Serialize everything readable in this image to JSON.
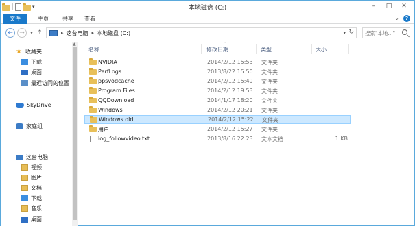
{
  "window": {
    "title": "本地磁盘 (C:)",
    "controls": {
      "minimize": "–",
      "maximize": "□",
      "close": "✕"
    }
  },
  "ribbon": {
    "file": "文件",
    "home": "主页",
    "share": "共享",
    "view": "查看",
    "help": "?"
  },
  "address": {
    "segments": [
      "这台电脑",
      "本地磁盘 (C:)"
    ]
  },
  "search": {
    "placeholder": "搜索\"本地...\""
  },
  "nav": {
    "favorites": "收藏夹",
    "fav_items": [
      "下载",
      "桌面",
      "最近访问的位置"
    ],
    "skydrive": "SkyDrive",
    "homegroup": "家庭组",
    "thispc": "这台电脑",
    "pc_items": [
      "视频",
      "图片",
      "文档",
      "下载",
      "音乐",
      "桌面"
    ]
  },
  "columns": {
    "name": "名称",
    "date": "修改日期",
    "type": "类型",
    "size": "大小"
  },
  "files": [
    {
      "name": "NVIDIA",
      "date": "2014/2/12 15:53",
      "type": "文件夹",
      "size": "",
      "kind": "folder"
    },
    {
      "name": "PerfLogs",
      "date": "2013/8/22 15:50",
      "type": "文件夹",
      "size": "",
      "kind": "folder"
    },
    {
      "name": "ppsvodcache",
      "date": "2014/2/12 15:49",
      "type": "文件夹",
      "size": "",
      "kind": "folder"
    },
    {
      "name": "Program Files",
      "date": "2014/2/12 19:53",
      "type": "文件夹",
      "size": "",
      "kind": "folder"
    },
    {
      "name": "QQDownload",
      "date": "2014/1/17 18:20",
      "type": "文件夹",
      "size": "",
      "kind": "folder"
    },
    {
      "name": "Windows",
      "date": "2014/2/12 20:21",
      "type": "文件夹",
      "size": "",
      "kind": "folder"
    },
    {
      "name": "Windows.old",
      "date": "2014/2/12 15:22",
      "type": "文件夹",
      "size": "",
      "kind": "folder",
      "selected": true
    },
    {
      "name": "用户",
      "date": "2014/2/12 15:27",
      "type": "文件夹",
      "size": "",
      "kind": "folder"
    },
    {
      "name": "log_followvideo.txt",
      "date": "2013/8/16 22:23",
      "type": "文本文档",
      "size": "1 KB",
      "kind": "text"
    }
  ]
}
